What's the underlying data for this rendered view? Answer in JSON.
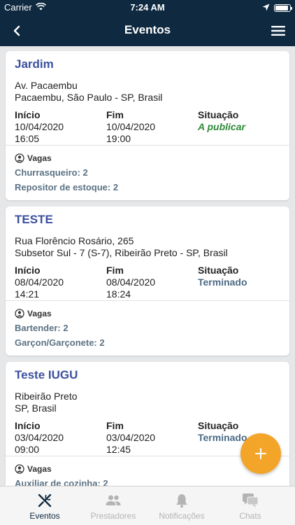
{
  "status_bar": {
    "carrier": "Carrier",
    "time": "7:24 AM",
    "battery_level": 0.9
  },
  "nav": {
    "title": "Eventos"
  },
  "labels": {
    "inicio": "Início",
    "fim": "Fim",
    "situacao": "Situação",
    "vagas": "Vagas"
  },
  "events": [
    {
      "title": "Jardim",
      "address_line1": "Av. Pacaembu",
      "address_line2": "Pacaembu, São Paulo - SP, Brasil",
      "inicio_date": "10/04/2020",
      "inicio_time": "16:05",
      "fim_date": "10/04/2020",
      "fim_time": "19:00",
      "situacao": "A publicar",
      "vagas": [
        "Churrasqueiro: 2",
        "Repositor de estoque: 2"
      ]
    },
    {
      "title": "TESTE",
      "address_line1": "Rua Florêncio Rosário, 265",
      "address_line2": "Subsetor Sul - 7 (S-7), Ribeirão Preto - SP, Brasil",
      "inicio_date": "08/04/2020",
      "inicio_time": "14:21",
      "fim_date": "08/04/2020",
      "fim_time": "18:24",
      "situacao": "Terminado",
      "vagas": [
        "Bartender: 2",
        "Garçon/Garçonete: 2"
      ]
    },
    {
      "title": "Teste IUGU",
      "address_line1": "Ribeirão Preto",
      "address_line2": "SP, Brasil",
      "inicio_date": "03/04/2020",
      "inicio_time": "09:00",
      "fim_date": "03/04/2020",
      "fim_time": "12:45",
      "situacao": "Terminado",
      "vagas": [
        "Auxiliar de cozinha: 2"
      ]
    }
  ],
  "fab": {
    "icon": "plus-icon",
    "color": "#f3a52a"
  },
  "tabs": [
    {
      "label": "Eventos",
      "icon": "cutlery-icon",
      "active": true
    },
    {
      "label": "Prestadores",
      "icon": "people-icon",
      "active": false
    },
    {
      "label": "Notificações",
      "icon": "bell-icon",
      "active": false
    },
    {
      "label": "Chats",
      "icon": "chat-icon",
      "active": false
    }
  ],
  "colors": {
    "header": "#0f2a40",
    "title": "#3b4f9e",
    "status_publish": "#2f8a3a",
    "status_done": "#4a6a85",
    "vaga_text": "#5b7283"
  }
}
